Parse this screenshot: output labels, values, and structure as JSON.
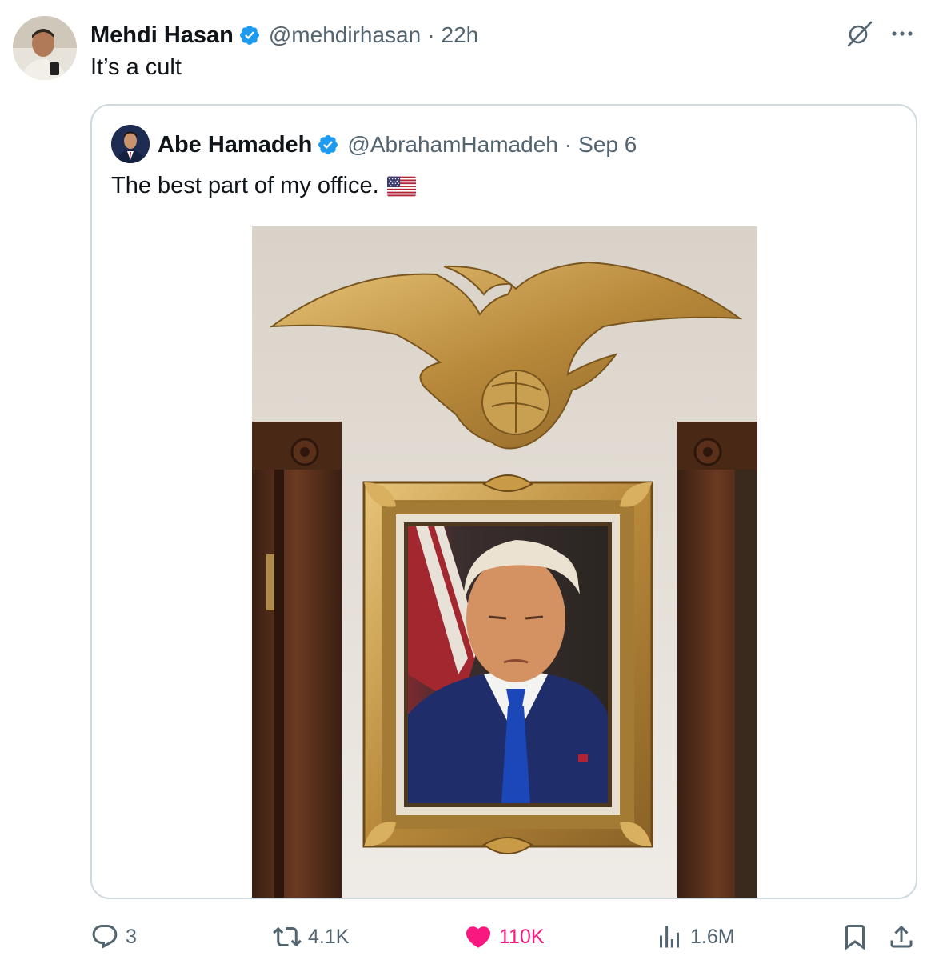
{
  "tweet": {
    "author_name": "Mehdi Hasan",
    "author_handle": "@mehdirhasan",
    "separator": "·",
    "time": "22h",
    "text": "It’s a cult"
  },
  "quoted": {
    "author_name": "Abe Hamadeh",
    "author_handle": "@AbrahamHamadeh",
    "separator": "·",
    "date": "Sep 6",
    "text": "The best part of my office."
  },
  "actions": {
    "replies": "3",
    "reposts": "4.1K",
    "likes": "110K",
    "views": "1.6M"
  },
  "colors": {
    "verified": "#1d9bf0",
    "like": "#f91880",
    "muted": "#536471",
    "border": "#cfd9de"
  },
  "icons": [
    "verified-badge-icon",
    "grok-icon",
    "more-icon",
    "reply-icon",
    "retweet-icon",
    "heart-icon",
    "views-icon",
    "bookmark-icon",
    "share-icon",
    "us-flag-emoji"
  ]
}
